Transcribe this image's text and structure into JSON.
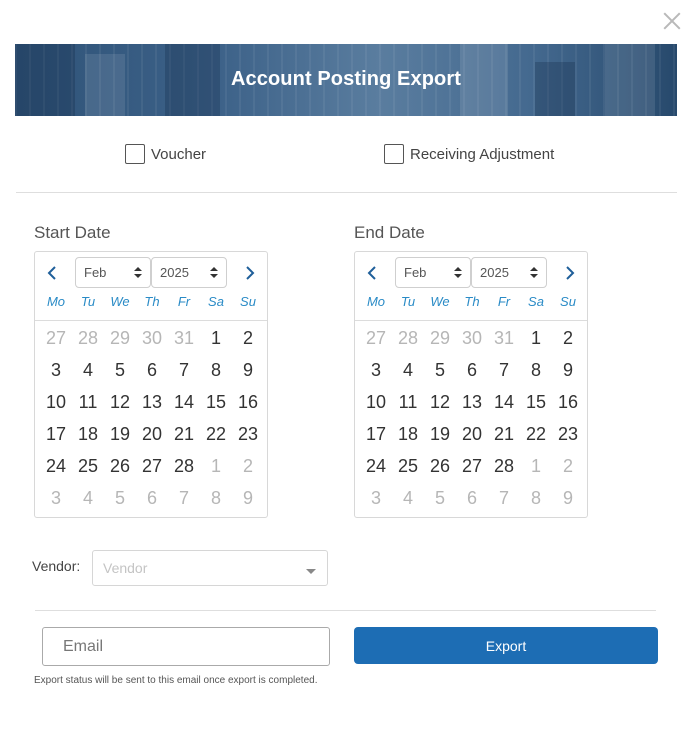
{
  "dialog": {
    "title": "Account Posting Export",
    "close_icon": "close-icon"
  },
  "options": {
    "voucher": {
      "label": "Voucher",
      "checked": false
    },
    "receiving_adjustment": {
      "label": "Receiving Adjustment",
      "checked": false
    }
  },
  "start_date": {
    "label": "Start Date",
    "month": "Feb",
    "year": "2025",
    "weekdays": [
      "Mo",
      "Tu",
      "We",
      "Th",
      "Fr",
      "Sa",
      "Su"
    ],
    "weeks": [
      [
        {
          "d": "27",
          "m": true
        },
        {
          "d": "28",
          "m": true
        },
        {
          "d": "29",
          "m": true
        },
        {
          "d": "30",
          "m": true
        },
        {
          "d": "31",
          "m": true
        },
        {
          "d": "1",
          "m": false
        },
        {
          "d": "2",
          "m": false
        }
      ],
      [
        {
          "d": "3",
          "m": false
        },
        {
          "d": "4",
          "m": false
        },
        {
          "d": "5",
          "m": false
        },
        {
          "d": "6",
          "m": false
        },
        {
          "d": "7",
          "m": false
        },
        {
          "d": "8",
          "m": false
        },
        {
          "d": "9",
          "m": false
        }
      ],
      [
        {
          "d": "10",
          "m": false
        },
        {
          "d": "11",
          "m": false
        },
        {
          "d": "12",
          "m": false
        },
        {
          "d": "13",
          "m": false
        },
        {
          "d": "14",
          "m": false
        },
        {
          "d": "15",
          "m": false
        },
        {
          "d": "16",
          "m": false
        }
      ],
      [
        {
          "d": "17",
          "m": false
        },
        {
          "d": "18",
          "m": false
        },
        {
          "d": "19",
          "m": false
        },
        {
          "d": "20",
          "m": false
        },
        {
          "d": "21",
          "m": false
        },
        {
          "d": "22",
          "m": false
        },
        {
          "d": "23",
          "m": false
        }
      ],
      [
        {
          "d": "24",
          "m": false
        },
        {
          "d": "25",
          "m": false
        },
        {
          "d": "26",
          "m": false
        },
        {
          "d": "27",
          "m": false
        },
        {
          "d": "28",
          "m": false
        },
        {
          "d": "1",
          "m": true
        },
        {
          "d": "2",
          "m": true
        }
      ],
      [
        {
          "d": "3",
          "m": true
        },
        {
          "d": "4",
          "m": true
        },
        {
          "d": "5",
          "m": true
        },
        {
          "d": "6",
          "m": true
        },
        {
          "d": "7",
          "m": true
        },
        {
          "d": "8",
          "m": true
        },
        {
          "d": "9",
          "m": true
        }
      ]
    ]
  },
  "end_date": {
    "label": "End Date",
    "month": "Feb",
    "year": "2025",
    "weekdays": [
      "Mo",
      "Tu",
      "We",
      "Th",
      "Fr",
      "Sa",
      "Su"
    ],
    "weeks": [
      [
        {
          "d": "27",
          "m": true
        },
        {
          "d": "28",
          "m": true
        },
        {
          "d": "29",
          "m": true
        },
        {
          "d": "30",
          "m": true
        },
        {
          "d": "31",
          "m": true
        },
        {
          "d": "1",
          "m": false
        },
        {
          "d": "2",
          "m": false
        }
      ],
      [
        {
          "d": "3",
          "m": false
        },
        {
          "d": "4",
          "m": false
        },
        {
          "d": "5",
          "m": false
        },
        {
          "d": "6",
          "m": false
        },
        {
          "d": "7",
          "m": false
        },
        {
          "d": "8",
          "m": false
        },
        {
          "d": "9",
          "m": false
        }
      ],
      [
        {
          "d": "10",
          "m": false
        },
        {
          "d": "11",
          "m": false
        },
        {
          "d": "12",
          "m": false
        },
        {
          "d": "13",
          "m": false
        },
        {
          "d": "14",
          "m": false
        },
        {
          "d": "15",
          "m": false
        },
        {
          "d": "16",
          "m": false
        }
      ],
      [
        {
          "d": "17",
          "m": false
        },
        {
          "d": "18",
          "m": false
        },
        {
          "d": "19",
          "m": false
        },
        {
          "d": "20",
          "m": false
        },
        {
          "d": "21",
          "m": false
        },
        {
          "d": "22",
          "m": false
        },
        {
          "d": "23",
          "m": false
        }
      ],
      [
        {
          "d": "24",
          "m": false
        },
        {
          "d": "25",
          "m": false
        },
        {
          "d": "26",
          "m": false
        },
        {
          "d": "27",
          "m": false
        },
        {
          "d": "28",
          "m": false
        },
        {
          "d": "1",
          "m": true
        },
        {
          "d": "2",
          "m": true
        }
      ],
      [
        {
          "d": "3",
          "m": true
        },
        {
          "d": "4",
          "m": true
        },
        {
          "d": "5",
          "m": true
        },
        {
          "d": "6",
          "m": true
        },
        {
          "d": "7",
          "m": true
        },
        {
          "d": "8",
          "m": true
        },
        {
          "d": "9",
          "m": true
        }
      ]
    ]
  },
  "vendor": {
    "label": "Vendor:",
    "placeholder": "Vendor"
  },
  "email": {
    "placeholder": "Email",
    "value": ""
  },
  "export": {
    "button_label": "Export",
    "hint": "Export status will be sent to this email once export is completed."
  },
  "colors": {
    "accent": "#1d6db4",
    "weekday": "#2a8bc6",
    "nav_arrow": "#1f5f9a",
    "muted_day": "#b6b6b6"
  },
  "icons": {
    "prev": "chevron-left-icon",
    "next": "chevron-right-icon",
    "dropdown": "caret-down-icon"
  }
}
